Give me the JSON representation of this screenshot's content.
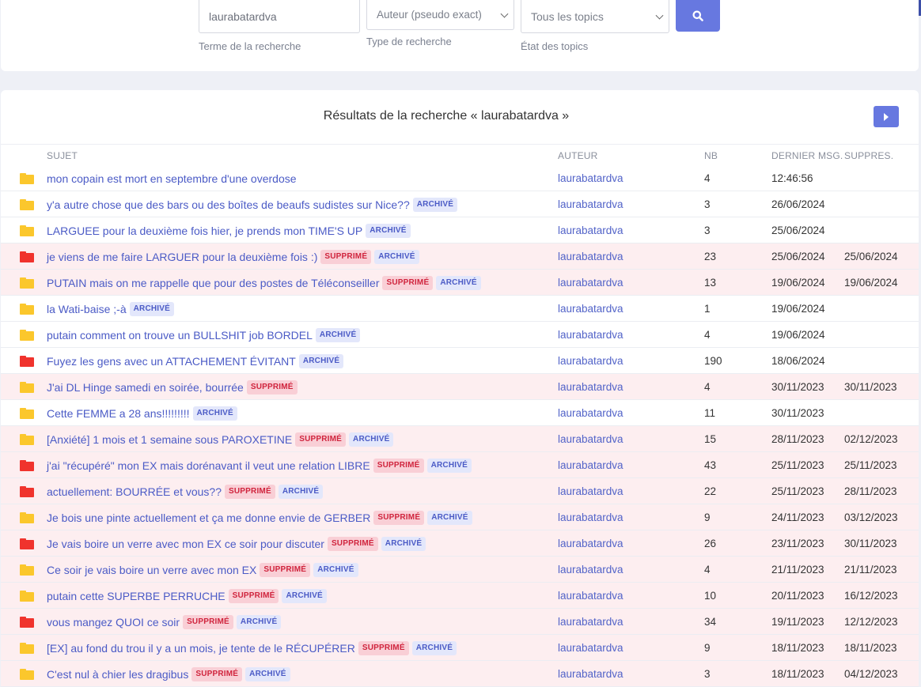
{
  "search": {
    "term_value": "laurabatardva",
    "term_help": "Terme de la recherche",
    "type_selected": "Auteur (pseudo exact)",
    "type_help": "Type de recherche",
    "state_selected": "Tous les topics",
    "state_help": "État des topics"
  },
  "results": {
    "title": "Résultats de la recherche « laurabatardva »",
    "columns": {
      "subject": "SUJET",
      "author": "AUTEUR",
      "nb": "NB",
      "last": "DERNIER MSG.",
      "deleted": "SUPPRES."
    },
    "badges": {
      "deleted": "SUPPRIMÉ",
      "archived": "ARCHIVÉ"
    },
    "colors": {
      "folder_normal": "#fbc72c",
      "folder_hot": "#f0332d",
      "accent": "#6778e0"
    },
    "rows": [
      {
        "subject": "mon copain est mort en septembre d'une overdose",
        "author": "laurabatardva",
        "nb": "4",
        "last": "12:46:56",
        "deleted": "",
        "is_deleted": false,
        "is_archived": false,
        "hot": false
      },
      {
        "subject": "y'a autre chose que des bars ou des boîtes de beaufs sudistes sur Nice??",
        "author": "laurabatardva",
        "nb": "3",
        "last": "26/06/2024",
        "deleted": "",
        "is_deleted": false,
        "is_archived": true,
        "hot": false
      },
      {
        "subject": "LARGUEE pour la deuxième fois hier, je prends mon TIME'S UP",
        "author": "laurabatardva",
        "nb": "3",
        "last": "25/06/2024",
        "deleted": "",
        "is_deleted": false,
        "is_archived": true,
        "hot": false
      },
      {
        "subject": "je viens de me faire LARGUER pour la deuxième fois :)",
        "author": "laurabatardva",
        "nb": "23",
        "last": "25/06/2024",
        "deleted": "25/06/2024",
        "is_deleted": true,
        "is_archived": true,
        "hot": true
      },
      {
        "subject": "PUTAIN mais on me rappelle que pour des postes de Téléconseiller",
        "author": "laurabatardva",
        "nb": "13",
        "last": "19/06/2024",
        "deleted": "19/06/2024",
        "is_deleted": true,
        "is_archived": true,
        "hot": false
      },
      {
        "subject": "la Wati-baise ;-à",
        "author": "laurabatardva",
        "nb": "1",
        "last": "19/06/2024",
        "deleted": "",
        "is_deleted": false,
        "is_archived": true,
        "hot": false
      },
      {
        "subject": "putain comment on trouve un BULLSHIT job BORDEL",
        "author": "laurabatardva",
        "nb": "4",
        "last": "19/06/2024",
        "deleted": "",
        "is_deleted": false,
        "is_archived": true,
        "hot": false
      },
      {
        "subject": "Fuyez les gens avec un ATTACHEMENT ÉVITANT",
        "author": "laurabatardva",
        "nb": "190",
        "last": "18/06/2024",
        "deleted": "",
        "is_deleted": false,
        "is_archived": true,
        "hot": true
      },
      {
        "subject": "J'ai DL Hinge samedi en soirée, bourrée",
        "author": "laurabatardva",
        "nb": "4",
        "last": "30/11/2023",
        "deleted": "30/11/2023",
        "is_deleted": true,
        "is_archived": false,
        "hot": false
      },
      {
        "subject": "Cette FEMME a 28 ans!!!!!!!!!",
        "author": "laurabatardva",
        "nb": "11",
        "last": "30/11/2023",
        "deleted": "",
        "is_deleted": false,
        "is_archived": true,
        "hot": false
      },
      {
        "subject": "[Anxiété] 1 mois et 1 semaine sous PAROXETINE",
        "author": "laurabatardva",
        "nb": "15",
        "last": "28/11/2023",
        "deleted": "02/12/2023",
        "is_deleted": true,
        "is_archived": true,
        "hot": false
      },
      {
        "subject": "j'ai \"récupéré\" mon EX mais dorénavant il veut une relation LIBRE",
        "author": "laurabatardva",
        "nb": "43",
        "last": "25/11/2023",
        "deleted": "25/11/2023",
        "is_deleted": true,
        "is_archived": true,
        "hot": true
      },
      {
        "subject": "actuellement: BOURRÉE et vous??",
        "author": "laurabatardva",
        "nb": "22",
        "last": "25/11/2023",
        "deleted": "28/11/2023",
        "is_deleted": true,
        "is_archived": true,
        "hot": true
      },
      {
        "subject": "Je bois une pinte actuellement et ça me donne envie de GERBER",
        "author": "laurabatardva",
        "nb": "9",
        "last": "24/11/2023",
        "deleted": "03/12/2023",
        "is_deleted": true,
        "is_archived": true,
        "hot": false
      },
      {
        "subject": "Je vais boire un verre avec mon EX ce soir pour discuter",
        "author": "laurabatardva",
        "nb": "26",
        "last": "23/11/2023",
        "deleted": "30/11/2023",
        "is_deleted": true,
        "is_archived": true,
        "hot": true
      },
      {
        "subject": "Ce soir je vais boire un verre avec mon EX",
        "author": "laurabatardva",
        "nb": "4",
        "last": "21/11/2023",
        "deleted": "21/11/2023",
        "is_deleted": true,
        "is_archived": true,
        "hot": false
      },
      {
        "subject": "putain cette SUPERBE PERRUCHE",
        "author": "laurabatardva",
        "nb": "10",
        "last": "20/11/2023",
        "deleted": "16/12/2023",
        "is_deleted": true,
        "is_archived": true,
        "hot": false
      },
      {
        "subject": "vous mangez QUOI ce soir",
        "author": "laurabatardva",
        "nb": "34",
        "last": "19/11/2023",
        "deleted": "12/12/2023",
        "is_deleted": true,
        "is_archived": true,
        "hot": true
      },
      {
        "subject": "[EX] au fond du trou il y a un mois, je tente de le RÉCUPÉRER",
        "author": "laurabatardva",
        "nb": "9",
        "last": "18/11/2023",
        "deleted": "18/11/2023",
        "is_deleted": true,
        "is_archived": true,
        "hot": false
      },
      {
        "subject": "C'est nul à chier les dragibus",
        "author": "laurabatardva",
        "nb": "3",
        "last": "18/11/2023",
        "deleted": "04/12/2023",
        "is_deleted": true,
        "is_archived": true,
        "hot": false
      }
    ]
  }
}
